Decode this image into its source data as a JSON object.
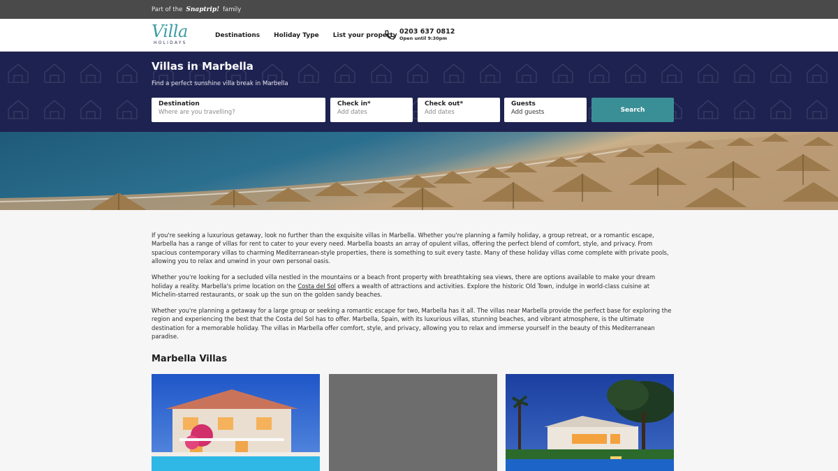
{
  "topbar": {
    "prefix": "Part of the",
    "brand": "Snaptrip!",
    "suffix": "family"
  },
  "header": {
    "logo_word": "Villa",
    "logo_sub": "HOLIDAYS",
    "nav": [
      "Destinations",
      "Holiday Type",
      "List your property"
    ],
    "phone_number": "0203 637 0812",
    "phone_hours": "Open until 9:30pm"
  },
  "hero": {
    "title": "Villas in Marbella",
    "subtitle": "Find a perfect sunshine villa break in Marbella",
    "destination": {
      "label": "Destination",
      "placeholder": "Where are you travelling?"
    },
    "checkin": {
      "label": "Check in*",
      "placeholder": "Add dates"
    },
    "checkout": {
      "label": "Check out*",
      "placeholder": "Add dates"
    },
    "guests": {
      "label": "Guests",
      "value": "Add guests"
    },
    "search_label": "Search"
  },
  "content": {
    "p1": "If you're seeking a luxurious getaway, look no further than the exquisite villas in Marbella. Whether you're planning a family holiday, a group retreat, or a romantic escape, Marbella has a range of villas for rent to cater to your every need. Marbella boasts an array of opulent villas, offering the perfect blend of comfort, style, and privacy. From spacious contemporary villas to charming Mediterranean-style properties, there is something to suit every taste. Many of these holiday villas come complete with private pools, allowing you to relax and unwind in your own personal oasis.",
    "p2_before": "Whether you're looking for a secluded villa nestled in the mountains or a beach front property with breathtaking sea views, there are options available to make your dream holiday a reality. Marbella's prime location on the ",
    "p2_link": "Costa del Sol",
    "p2_after": " offers a wealth of attractions and activities. Explore the historic Old Town, indulge in world-class cuisine at Michelin-starred restaurants, or soak up the sun on the golden sandy beaches.",
    "p3": "Whether you're planning a getaway for a large group or seeking a romantic escape for two, Marbella has it all. The villas near Marbella provide the perfect base for exploring the region and experiencing the best that the Costa del Sol has to offer. Marbella, Spain, with its luxurious villas, stunning beaches, and vibrant atmosphere, is the ultimate destination for a memorable holiday. The villas in Marbella offer comfort, style, and privacy, allowing you to relax and immerse yourself in the beauty of this Mediterranean paradise."
  },
  "section": {
    "title": "Marbella Villas"
  },
  "colors": {
    "topbar": "#4a4a4a",
    "hero": "#1e2250",
    "accent": "#3a8f96",
    "logo": "#3d9da5"
  },
  "icons": {
    "phone": "phone-icon"
  }
}
